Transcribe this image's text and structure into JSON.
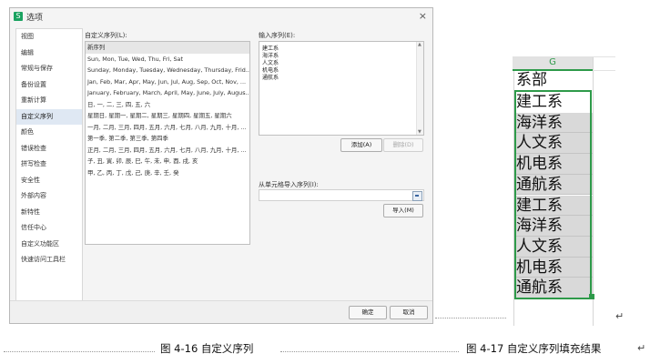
{
  "dialog": {
    "app_icon": "S",
    "title": "选项",
    "close_glyph": "×",
    "sidebar": [
      {
        "label": "视图"
      },
      {
        "label": "编辑"
      },
      {
        "label": "常规与保存"
      },
      {
        "label": "备份设置"
      },
      {
        "label": "重新计算"
      },
      {
        "label": "自定义序列",
        "active": true
      },
      {
        "label": "颜色"
      },
      {
        "label": "错误检查"
      },
      {
        "label": "拼写检查"
      },
      {
        "label": "安全性"
      },
      {
        "label": "外部内容"
      },
      {
        "label": "新特性"
      },
      {
        "label": "信任中心"
      },
      {
        "label": "自定义功能区"
      },
      {
        "label": "快速访问工具栏"
      }
    ],
    "custom_lists_label": "自定义序列(L):",
    "custom_lists": [
      "新序列",
      "Sun, Mon, Tue, Wed, Thu, Fri, Sat",
      "Sunday, Monday, Tuesday, Wednesday, Thursday, Frid...",
      "Jan, Feb, Mar, Apr, May, Jun, Jul, Aug, Sep, Oct, Nov, ...",
      "January, February, March, April, May, June, July, Augus...",
      "日, 一, 二, 三, 四, 五, 六",
      "星期日, 星期一, 星期二, 星期三, 星期四, 星期五, 星期六",
      "一月, 二月, 三月, 四月, 五月, 六月, 七月, 八月, 九月, 十月, ...",
      "第一季, 第二季, 第三季, 第四季",
      "正月, 二月, 三月, 四月, 五月, 六月, 七月, 八月, 九月, 十月, ...",
      "子, 丑, 寅, 卯, 辰, 巳, 午, 未, 申, 酉, 戌, 亥",
      "甲, 乙, 丙, 丁, 戊, 己, 庚, 辛, 壬, 癸"
    ],
    "entries_label": "输入序列(E):",
    "entries": [
      "建工系",
      "海洋系",
      "人文系",
      "机电系",
      "通航系"
    ],
    "add_button": "添加(A)",
    "delete_button": "删除(D)",
    "import_label": "从单元格导入序列(I):",
    "import_value": "",
    "import_button": "导入(M)",
    "ok_button": "确定",
    "cancel_button": "取消"
  },
  "sheet": {
    "column_letter": "G",
    "header_cell": "系部",
    "cells": [
      "建工系",
      "海洋系",
      "人文系",
      "机电系",
      "通航系",
      "建工系",
      "海洋系",
      "人文系",
      "机电系",
      "通航系"
    ]
  },
  "captions": {
    "left": "图 4-16 自定义序列",
    "right": "图 4-17 自定义序列填充结果",
    "return_mark": "↵"
  },
  "colors": {
    "accent_green": "#2e9a4a",
    "selected_sidebar": "#dfe8f3",
    "filled_cell": "#d9d9d9"
  }
}
